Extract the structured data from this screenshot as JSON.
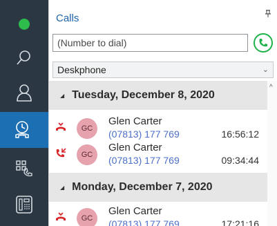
{
  "panel": {
    "title": "Calls",
    "dial_placeholder": "(Number to dial)",
    "device": "Deskphone"
  },
  "groups": [
    {
      "date": "Tuesday, December 8, 2020",
      "calls": [
        {
          "name": "Glen Carter",
          "initials": "GC",
          "number": "(07813) 177 769",
          "time": "16:56:12",
          "type": "missed"
        },
        {
          "name": "Glen Carter",
          "initials": "GC",
          "number": "(07813) 177 769",
          "time": "09:34:44",
          "type": "incoming"
        }
      ]
    },
    {
      "date": "Monday, December 7, 2020",
      "calls": [
        {
          "name": "Glen Carter",
          "initials": "GC",
          "number": "(07813) 177 769",
          "time": "17:21:16",
          "type": "missed"
        }
      ]
    }
  ],
  "colors": {
    "rail": "#2b3844",
    "rail_active": "#1c6fb3",
    "status_online": "#2ebd4a",
    "title": "#1f63a8",
    "call_green": "#1fb24a",
    "missed_red": "#d9262a",
    "avatar": "#e6a3ad",
    "number_link": "#4b6fc9"
  }
}
